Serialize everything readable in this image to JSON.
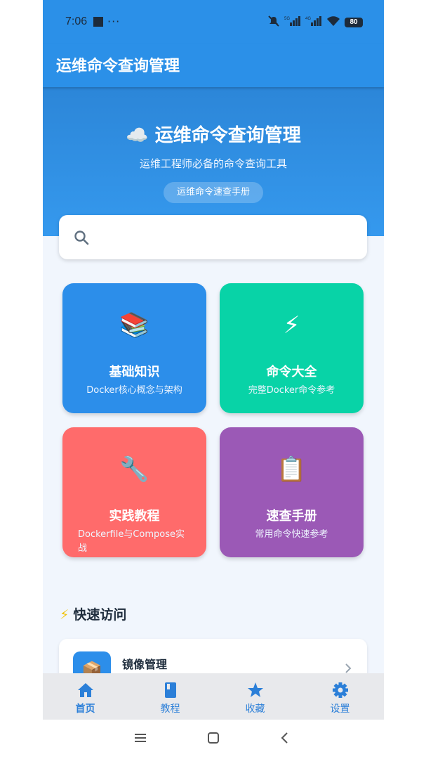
{
  "status": {
    "time": "7:06",
    "dots": "···",
    "net1": "5G",
    "net2": "4G",
    "battery": "80"
  },
  "app": {
    "title": "运维命令查询管理"
  },
  "hero": {
    "emoji": "☁️",
    "title": "运维命令查询管理",
    "subtitle": "运维工程师必备的命令查询工具",
    "pill": "运维命令速查手册"
  },
  "search": {
    "placeholder": "",
    "value": ""
  },
  "cards": [
    {
      "emoji": "📚",
      "title": "基础知识",
      "subtitle": "Docker核心概念与架构",
      "color": "#2c8eea"
    },
    {
      "emoji": "⚡",
      "title": "命令大全",
      "subtitle": "完整Docker命令参考",
      "color": "#08d3a7"
    },
    {
      "emoji": "🔧",
      "title": "实践教程",
      "subtitle": "Dockerfile与Compose实战",
      "color": "#ff6b6b"
    },
    {
      "emoji": "📋",
      "title": "速查手册",
      "subtitle": "常用命令快速参考",
      "color": "#9b59b6"
    }
  ],
  "quick": {
    "icon": "⚡",
    "title": "快速访问",
    "items": [
      {
        "emoji": "📦",
        "label": "镜像管理"
      }
    ]
  },
  "nav": [
    {
      "icon": "home-icon",
      "label": "首页",
      "active": true
    },
    {
      "icon": "book-icon",
      "label": "教程"
    },
    {
      "icon": "star-icon",
      "label": "收藏"
    },
    {
      "icon": "gear-icon",
      "label": "设置"
    }
  ],
  "colors": {
    "primary": "#2b90e8",
    "nav_active": "#2b7fd8"
  }
}
